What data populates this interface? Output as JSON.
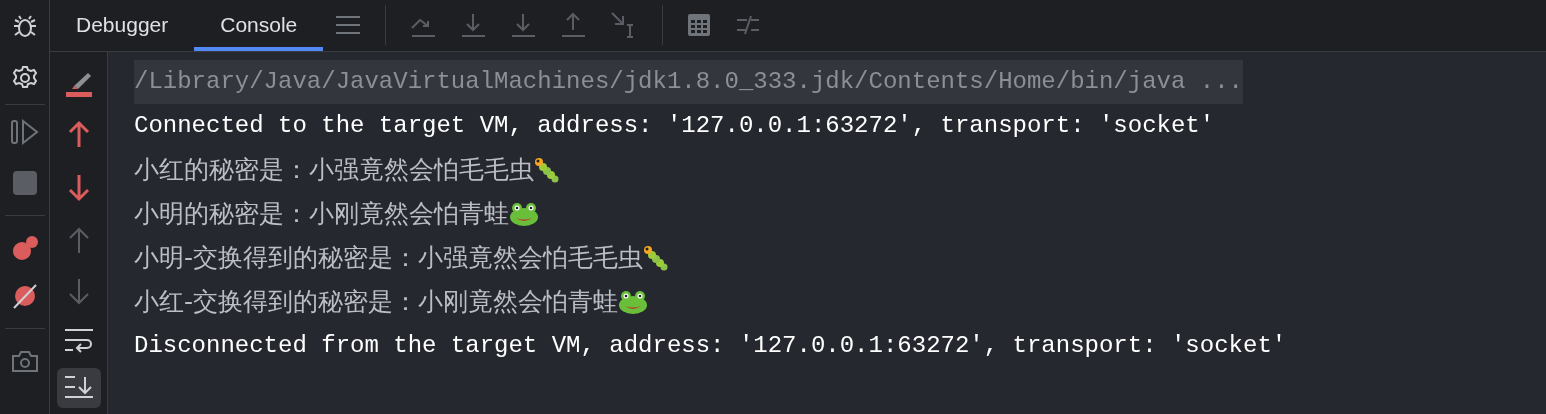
{
  "tabs": [
    {
      "label": "Debugger",
      "selected": false
    },
    {
      "label": "Console",
      "selected": true
    }
  ],
  "console_lines": [
    {
      "kind": "command",
      "text": "/Library/Java/JavaVirtualMachines/jdk1.8.0_333.jdk/Contents/Home/bin/java ..."
    },
    {
      "kind": "system",
      "text": "Connected to the target VM, address: '127.0.0.1:63272', transport: 'socket'"
    },
    {
      "kind": "output",
      "text": "小红的秘密是：小强竟然会怕毛毛虫",
      "trailing": {
        "kind": "caterpillar"
      }
    },
    {
      "kind": "output",
      "text": "小明的秘密是：小刚竟然会怕青蛙",
      "trailing": {
        "kind": "frog"
      }
    },
    {
      "kind": "output",
      "text": "小明-交换得到的秘密是：小强竟然会怕毛毛虫",
      "trailing": {
        "kind": "caterpillar"
      }
    },
    {
      "kind": "output",
      "text": "小红-交换得到的秘密是：小刚竟然会怕青蛙",
      "trailing": {
        "kind": "frog"
      }
    },
    {
      "kind": "system",
      "text": "Disconnected from the target VM, address: '127.0.0.1:63272', transport: 'socket'"
    }
  ],
  "scroll_to_end": {
    "on": true
  }
}
